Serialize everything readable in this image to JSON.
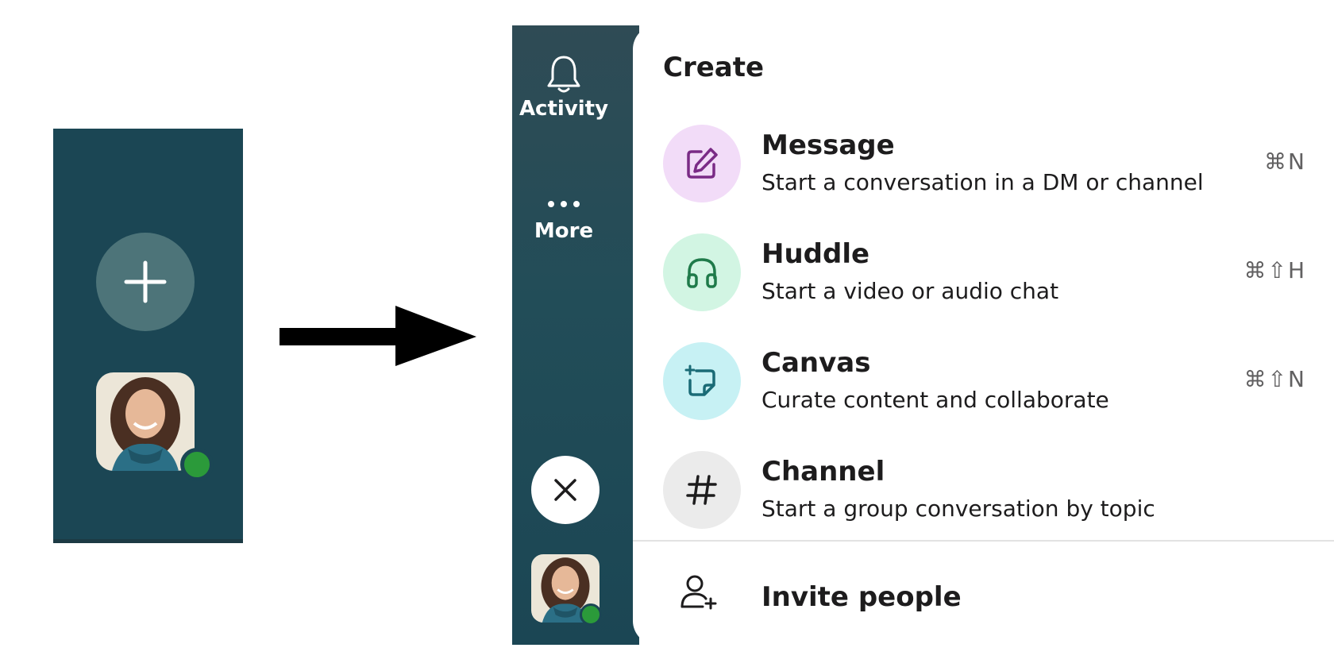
{
  "collapsed": {
    "plus_icon": "plus-icon",
    "avatar_alt": "user-avatar"
  },
  "sidebar": {
    "activity": {
      "label": "Activity",
      "icon": "bell-icon"
    },
    "more": {
      "label": "More",
      "icon": "ellipsis-icon"
    },
    "close_icon": "close-icon"
  },
  "menu": {
    "title": "Create",
    "items": [
      {
        "title": "Message",
        "description": "Start a conversation in a DM or channel",
        "shortcut": "⌘N",
        "icon": "compose-icon",
        "icon_bg": "#f2dcf8",
        "icon_color": "#7a2b86"
      },
      {
        "title": "Huddle",
        "description": "Start a video or audio chat",
        "shortcut": "⌘⇧H",
        "icon": "headphones-icon",
        "icon_bg": "#d2f5e3",
        "icon_color": "#1f7a4a"
      },
      {
        "title": "Canvas",
        "description": "Curate content and collaborate",
        "shortcut": "⌘⇧N",
        "icon": "canvas-icon",
        "icon_bg": "#c7f1f4",
        "icon_color": "#1a6b76"
      },
      {
        "title": "Channel",
        "description": "Start a group conversation by topic",
        "shortcut": "",
        "icon": "hash-icon",
        "icon_bg": "#ebebeb",
        "icon_color": "#1d1c1d"
      }
    ],
    "invite": {
      "label": "Invite people",
      "icon": "add-person-icon"
    }
  },
  "colors": {
    "sidebar_bg": "#1b4654",
    "presence": "#2b9a3a"
  }
}
